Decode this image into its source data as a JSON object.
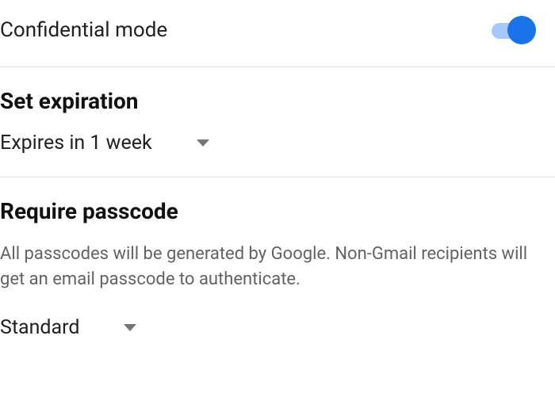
{
  "confidential": {
    "label": "Confidential mode",
    "enabled": true
  },
  "expiration": {
    "title": "Set expiration",
    "selected": "Expires in 1 week"
  },
  "passcode": {
    "title": "Require passcode",
    "description": "All passcodes will be generated by Google. Non-Gmail recipients will get an email passcode to authenticate.",
    "selected": "Standard"
  }
}
